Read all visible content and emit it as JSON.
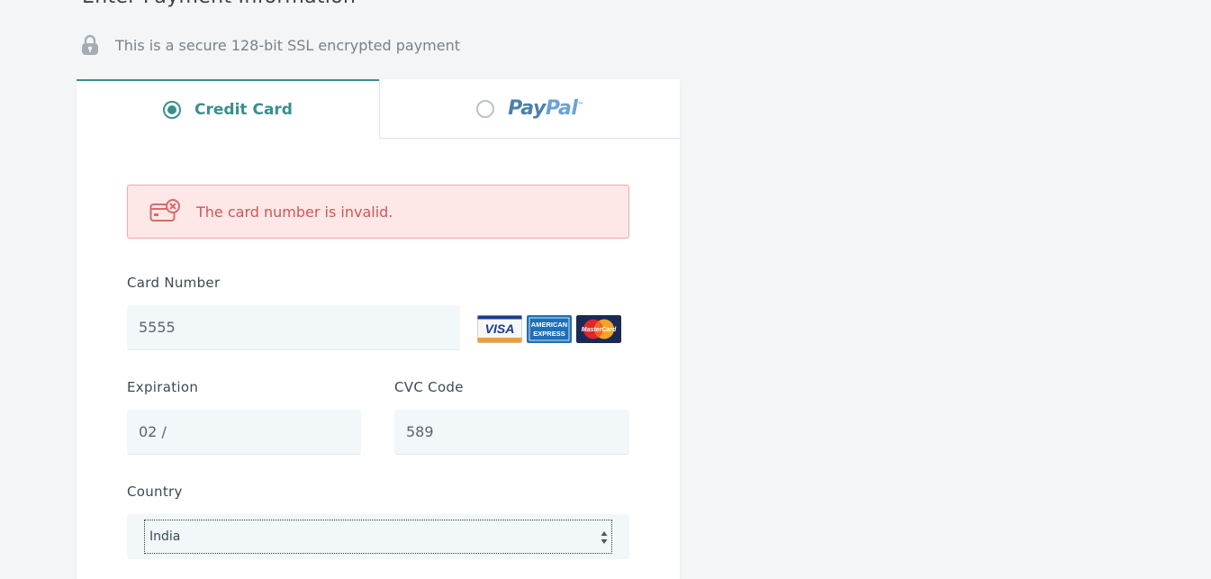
{
  "heading": "Enter Payment Information",
  "secure_text": "This is a secure 128-bit SSL encrypted payment",
  "tabs": {
    "credit_card": "Credit Card",
    "paypal_part1": "Pay",
    "paypal_part2": "Pal"
  },
  "alert": {
    "message": "The card number is invalid."
  },
  "fields": {
    "card_number_label": "Card Number",
    "card_number_value": "5555",
    "expiration_label": "Expiration",
    "expiration_value": "02 /",
    "cvc_label": "CVC Code",
    "cvc_value": "589",
    "country_label": "Country",
    "country_value": "India"
  },
  "card_brands": [
    "VISA",
    "AMERICAN EXPRESS",
    "MasterCard"
  ],
  "colors": {
    "accent": "#3a8f8e",
    "error_text": "#d05656",
    "error_bg": "#fde7e7",
    "input_bg": "#f2f7f9"
  }
}
